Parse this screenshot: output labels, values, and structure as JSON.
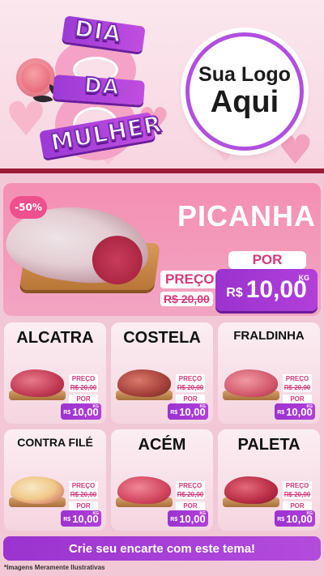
{
  "header": {
    "title_words": [
      "DIA",
      "DA",
      "MULHER"
    ],
    "logo_line1": "Sua Logo",
    "logo_line2": "Aqui"
  },
  "hero": {
    "discount": "-50%",
    "name": "PICANHA",
    "preco_label": "PREÇO",
    "old_price": "R$ 20,00",
    "por_label": "POR",
    "currency": "R$",
    "price": "10,00",
    "unit": "KG"
  },
  "products": [
    {
      "name": "ALCATRA",
      "preco_label": "PREÇO",
      "old_price": "R$ 20,00",
      "por_label": "POR",
      "currency": "R$",
      "price": "10,00",
      "unit": "KG"
    },
    {
      "name": "COSTELA",
      "preco_label": "PREÇO",
      "old_price": "R$ 20,00",
      "por_label": "POR",
      "currency": "R$",
      "price": "10,00",
      "unit": "KG"
    },
    {
      "name": "FRALDINHA",
      "preco_label": "PREÇO",
      "old_price": "R$ 20,00",
      "por_label": "POR",
      "currency": "R$",
      "price": "10,00",
      "unit": "KG"
    },
    {
      "name": "CONTRA FILÉ",
      "preco_label": "PREÇO",
      "old_price": "R$ 20,00",
      "por_label": "POR",
      "currency": "R$",
      "price": "10,00",
      "unit": "KG"
    },
    {
      "name": "ACÉM",
      "preco_label": "PREÇO",
      "old_price": "R$ 20,00",
      "por_label": "POR",
      "currency": "R$",
      "price": "10,00",
      "unit": "KG"
    },
    {
      "name": "PALETA",
      "preco_label": "PREÇO",
      "old_price": "R$ 20,00",
      "por_label": "POR",
      "currency": "R$",
      "price": "10,00",
      "unit": "KG"
    }
  ],
  "cta_label": "Crie seu encarte com este tema!",
  "footnote": "*Imagens Meramente Ilustrativas",
  "colors": {
    "accent_purple": "#9a33cf",
    "accent_pink": "#d6387a",
    "hero_bg": "#f48fb3",
    "divider": "#9b1b34"
  }
}
